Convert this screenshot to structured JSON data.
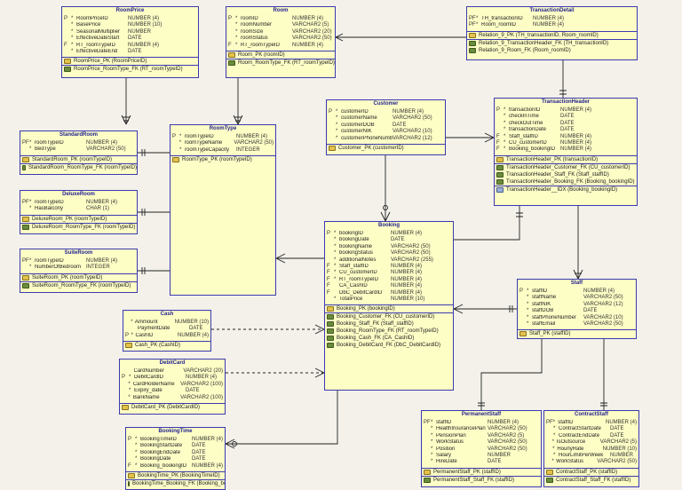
{
  "entities": {
    "roomprice": {
      "name": "RoomPrice",
      "attrs": [
        {
          "k": "P",
          "m": "*",
          "n": "RoomPriceID",
          "t": "NUMBER (4)"
        },
        {
          "k": "",
          "m": "*",
          "n": "BasePrice",
          "t": "NUMBER (10)"
        },
        {
          "k": "",
          "m": "*",
          "n": "SeasonalMultiplier",
          "t": "NUMBER"
        },
        {
          "k": "",
          "m": "*",
          "n": "EffectiveDateStart",
          "t": "DATE"
        },
        {
          "k": "F",
          "m": "*",
          "n": "RT_roomTypeID",
          "t": "NUMBER (4)"
        },
        {
          "k": "",
          "m": "*",
          "n": "EffectiveDateEnd",
          "t": "DATE"
        }
      ],
      "pk": [
        "RoomPrice_PK (RoomPriceID)"
      ],
      "fk": [
        "RoomPrice_RoomType_FK (RT_roomTypeID)"
      ]
    },
    "room": {
      "name": "Room",
      "attrs": [
        {
          "k": "P",
          "m": "*",
          "n": "roomID",
          "t": "NUMBER (4)"
        },
        {
          "k": "",
          "m": "*",
          "n": "roomNumber",
          "t": "VARCHAR2 (5)"
        },
        {
          "k": "",
          "m": "*",
          "n": "roomSize",
          "t": "VARCHAR2 (20)"
        },
        {
          "k": "",
          "m": "*",
          "n": "roomStatus",
          "t": "VARCHAR2 (50)"
        },
        {
          "k": "F",
          "m": "*",
          "n": "RT_roomTypeID",
          "t": "NUMBER (4)"
        }
      ],
      "pk": [
        "Room_PK (roomID)"
      ],
      "fk": [
        "Room_RoomType_FK (RT_roomTypeID)"
      ]
    },
    "transactiondetail": {
      "name": "TransactionDetail",
      "attrs": [
        {
          "k": "PF",
          "m": "*",
          "n": "TH_transactionID",
          "t": "NUMBER (4)"
        },
        {
          "k": "PF",
          "m": "*",
          "n": "Room_roomID",
          "t": "NUMBER (4)"
        }
      ],
      "pk": [
        "Relation_9_PK (TH_transactionID, Room_roomID)"
      ],
      "fk": [
        "Relation_9_TransactionHeader_FK (TH_transactionID)",
        "Relation_9_Room_FK (Room_roomID)"
      ]
    },
    "standardroom": {
      "name": "StandardRoom",
      "attrs": [
        {
          "k": "PF",
          "m": "*",
          "n": "roomTypeID",
          "t": "NUMBER (4)"
        },
        {
          "k": "",
          "m": "*",
          "n": "BedType",
          "t": "VARCHAR2 (50)"
        }
      ],
      "pk": [
        "StandardRoom_PK (roomTypeID)"
      ],
      "fk": [
        "StandardRoom_RoomType_FK (roomTypeID)"
      ]
    },
    "roomtype": {
      "name": "RoomType",
      "attrs": [
        {
          "k": "P",
          "m": "*",
          "n": "roomTypeID",
          "t": "NUMBER (4)"
        },
        {
          "k": "",
          "m": "*",
          "n": "roomTypeName",
          "t": "VARCHAR2 (50)"
        },
        {
          "k": "",
          "m": "*",
          "n": "roomTypeCapacity",
          "t": "INTEGER"
        }
      ],
      "pk": [
        "RoomType_PK (roomTypeID)"
      ],
      "fk": []
    },
    "customer": {
      "name": "Customer",
      "attrs": [
        {
          "k": "P",
          "m": "*",
          "n": "customerID",
          "t": "NUMBER (4)"
        },
        {
          "k": "",
          "m": "*",
          "n": "customerName",
          "t": "VARCHAR2 (50)"
        },
        {
          "k": "",
          "m": "*",
          "n": "customerDOB",
          "t": "DATE"
        },
        {
          "k": "",
          "m": "*",
          "n": "customerNIK",
          "t": "VARCHAR2 (10)"
        },
        {
          "k": "",
          "m": "*",
          "n": "customerPhoneNumber",
          "t": "VARCHAR2 (12)"
        }
      ],
      "pk": [
        "Customer_PK (customerID)"
      ],
      "fk": []
    },
    "transactionheader": {
      "name": "TransactionHeader",
      "attrs": [
        {
          "k": "P",
          "m": "*",
          "n": "transactionID",
          "t": "NUMBER (4)"
        },
        {
          "k": "",
          "m": "*",
          "n": "checkInTime",
          "t": "DATE"
        },
        {
          "k": "",
          "m": "*",
          "n": "checkOutTime",
          "t": "DATE"
        },
        {
          "k": "",
          "m": "*",
          "n": "transactionDate",
          "t": "DATE"
        },
        {
          "k": "F",
          "m": "*",
          "n": "Staff_staffID",
          "t": "NUMBER (4)"
        },
        {
          "k": "F",
          "m": "*",
          "n": "CU_customerID",
          "t": "NUMBER (4)"
        },
        {
          "k": "F",
          "m": "*",
          "n": "Booking_bookingID",
          "t": "NUMBER (4)"
        }
      ],
      "pk": [
        "TransactionHeader_PK (transactionID)"
      ],
      "fk": [
        "TransactionHeader_Customer_FK (CU_customerID)",
        "TransactionHeader_Staff_FK (Staff_staffID)",
        "TransactionHeader_Booking_FK (Booking_bookingID)"
      ],
      "idx": [
        "TransactionHeader__IDX (Booking_bookingID)"
      ]
    },
    "deluxeroom": {
      "name": "DeluxeRoom",
      "attrs": [
        {
          "k": "PF",
          "m": "*",
          "n": "roomTypeID",
          "t": "NUMBER (4)"
        },
        {
          "k": "",
          "m": "*",
          "n": "HasBalcony",
          "t": "CHAR (1)"
        }
      ],
      "pk": [
        "DeluxeRoom_PK (roomTypeID)"
      ],
      "fk": [
        "DeluxeRoom_RoomType_FK (roomTypeID)"
      ]
    },
    "suiteroom": {
      "name": "SuiteRoom",
      "attrs": [
        {
          "k": "PF",
          "m": "*",
          "n": "roomTypeID",
          "t": "NUMBER (4)"
        },
        {
          "k": "",
          "m": "*",
          "n": "NumberOfBedroom",
          "t": "INTEGER"
        }
      ],
      "pk": [
        "SuiteRoom_PK (roomTypeID)"
      ],
      "fk": [
        "SuiteRoom_RoomType_FK (roomTypeID)"
      ]
    },
    "booking": {
      "name": "Booking",
      "attrs": [
        {
          "k": "P",
          "m": "*",
          "n": "bookingID",
          "t": "NUMBER (4)"
        },
        {
          "k": "",
          "m": "*",
          "n": "bookingDate",
          "t": "DATE"
        },
        {
          "k": "",
          "m": "*",
          "n": "bookingName",
          "t": "VARCHAR2 (50)"
        },
        {
          "k": "",
          "m": "*",
          "n": "bookingStatus",
          "t": "VARCHAR2 (50)"
        },
        {
          "k": "",
          "m": "*",
          "n": "additionalNotes",
          "t": "VARCHAR2 (255)"
        },
        {
          "k": "F",
          "m": "*",
          "n": "Staff_staffID",
          "t": "NUMBER (4)"
        },
        {
          "k": "F",
          "m": "*",
          "n": "CU_customerID",
          "t": "NUMBER (4)"
        },
        {
          "k": "F",
          "m": "*",
          "n": "RT_roomTypeID",
          "t": "NUMBER (4)"
        },
        {
          "k": "F",
          "m": "",
          "n": "CA_CashID",
          "t": "NUMBER (4)"
        },
        {
          "k": "F",
          "m": "",
          "n": "DbC_DebitCardID",
          "t": "NUMBER (4)"
        },
        {
          "k": "",
          "m": "*",
          "n": "TotalPrice",
          "t": "NUMBER (10)"
        }
      ],
      "pk": [
        "Booking_PK (bookingID)"
      ],
      "fk": [
        "Booking_Customer_FK (CU_customerID)",
        "Booking_Staff_FK (Staff_staffID)",
        "Booking_RoomType_FK (RT_roomTypeID)",
        "Booking_Cash_FK (CA_CashID)",
        "Booking_DebitCard_FK (DbC_DebitCardID)"
      ]
    },
    "staff": {
      "name": "Staff",
      "attrs": [
        {
          "k": "P",
          "m": "*",
          "n": "staffID",
          "t": "NUMBER (4)"
        },
        {
          "k": "",
          "m": "*",
          "n": "staffName",
          "t": "VARCHAR2 (50)"
        },
        {
          "k": "",
          "m": "*",
          "n": "staffNIK",
          "t": "VARCHAR2 (12)"
        },
        {
          "k": "",
          "m": "*",
          "n": "staffDOB",
          "t": "DATE"
        },
        {
          "k": "",
          "m": "*",
          "n": "staffPhoneNumber",
          "t": "VARCHAR2 (10)"
        },
        {
          "k": "",
          "m": "*",
          "n": "staffEmail",
          "t": "VARCHAR2 (50)"
        }
      ],
      "pk": [
        "Staff_PK (staffID)"
      ],
      "fk": []
    },
    "cash": {
      "name": "Cash",
      "attrs": [
        {
          "k": "",
          "m": "*",
          "n": "Ammount",
          "t": "NUMBER (10)"
        },
        {
          "k": "",
          "m": "",
          "n": "PaymentDate",
          "t": "DATE"
        },
        {
          "k": "P",
          "m": "*",
          "n": "CashID",
          "t": "NUMBER (4)"
        }
      ],
      "pk": [
        "Cash_PK (CashID)"
      ],
      "fk": []
    },
    "debitcard": {
      "name": "DebitCard",
      "attrs": [
        {
          "k": "",
          "m": "",
          "n": "CardNumber",
          "t": "VARCHAR2 (20)"
        },
        {
          "k": "P",
          "m": "*",
          "n": "DebitCardID",
          "t": "NUMBER (4)"
        },
        {
          "k": "",
          "m": "*",
          "n": "CardHolderName",
          "t": "VARCHAR2 (100)"
        },
        {
          "k": "",
          "m": "*",
          "n": "Expiry_date",
          "t": "DATE"
        },
        {
          "k": "",
          "m": "*",
          "n": "BankName",
          "t": "VARCHAR2 (100)"
        }
      ],
      "pk": [
        "DebitCard_PK (DebitCardID)"
      ],
      "fk": []
    },
    "bookingtime": {
      "name": "BookingTime",
      "attrs": [
        {
          "k": "P",
          "m": "*",
          "n": "BookingTimeID",
          "t": "NUMBER (4)"
        },
        {
          "k": "",
          "m": "*",
          "n": "BookingStartDate",
          "t": "DATE"
        },
        {
          "k": "",
          "m": "*",
          "n": "BookingEndDate",
          "t": "DATE"
        },
        {
          "k": "",
          "m": "*",
          "n": "BookingDate",
          "t": "DATE"
        },
        {
          "k": "F",
          "m": "*",
          "n": "Booking_bookingID",
          "t": "NUMBER (4)"
        }
      ],
      "pk": [
        "BookingTime_PK (BookingTimeID)"
      ],
      "fk": [
        "BookingTime_Booking_FK (Booking_bookingID)"
      ]
    },
    "permanentstaff": {
      "name": "PermanentStaff",
      "attrs": [
        {
          "k": "PF",
          "m": "*",
          "n": "staffID",
          "t": "NUMBER (4)"
        },
        {
          "k": "",
          "m": "*",
          "n": "HealthInsurancePlan",
          "t": "VARCHAR2 (50)"
        },
        {
          "k": "",
          "m": "*",
          "n": "PensionPlan",
          "t": "VARCHAR2 (5)"
        },
        {
          "k": "",
          "m": "*",
          "n": "WorkStatus",
          "t": "VARCHAR2 (50)"
        },
        {
          "k": "",
          "m": "*",
          "n": "Position",
          "t": "VARCHAR2 (50)"
        },
        {
          "k": "",
          "m": "*",
          "n": "Salary",
          "t": "NUMBER"
        },
        {
          "k": "",
          "m": "*",
          "n": "HireDate",
          "t": "DATE"
        }
      ],
      "pk": [
        "PermanentStaff_PK (staffID)"
      ],
      "fk": [
        "PermanentStaff_Staff_FK (staffID)"
      ]
    },
    "contractstaff": {
      "name": "ContractStaff",
      "attrs": [
        {
          "k": "PF",
          "m": "*",
          "n": "staffID",
          "t": "NUMBER (4)"
        },
        {
          "k": "",
          "m": "*",
          "n": "ContractStartDate",
          "t": "DATE"
        },
        {
          "k": "",
          "m": "*",
          "n": "ContractEndDate",
          "t": "DATE"
        },
        {
          "k": "",
          "m": "*",
          "n": "IsOutsource",
          "t": "VARCHAR2 (5)"
        },
        {
          "k": "",
          "m": "*",
          "n": "HourlyRate",
          "t": "NUMBER (10)"
        },
        {
          "k": "",
          "m": "*",
          "n": "HourLimitPerWeek",
          "t": "NUMBER"
        },
        {
          "k": "",
          "m": "*",
          "n": "WorkStatus",
          "t": "VARCHAR2 (50)"
        }
      ],
      "pk": [
        "ContractStaff_PK (staffID)"
      ],
      "fk": [
        "ContractStaff_Staff_FK (staffID)"
      ]
    }
  }
}
